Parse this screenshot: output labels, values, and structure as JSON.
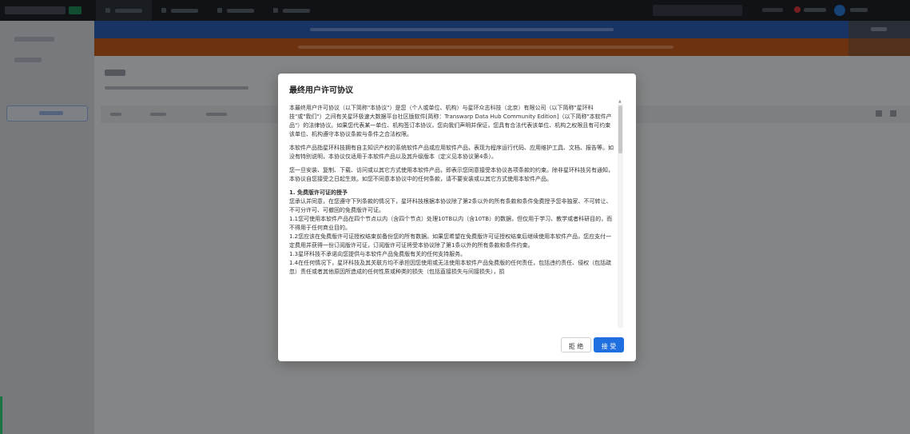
{
  "colors": {
    "accent": "#1f6fe0",
    "top_bar": "#1f2229",
    "banner_blue": "#2d5fb8",
    "banner_orange": "#c75b1d"
  },
  "modal": {
    "title": "最终用户许可协议",
    "paragraphs": [
      "本最终用户许可协议（以下简称\"本协议\"）是您（个人或单位、机构）与星环众志科技（北京）有限公司（以下简称\"星环科技\"或\"我们\"）之间有关星环极速大数据平台社区版软件[简称：Transwarp Data Hub Community Edition]（以下简称\"本软件产品\"）的法律协议。如果您代表某一单位、机构签订本协议，您向我们声明并保证，您具有合法代表该单位、机构之权限且有可约束该单位、机构遵守本协议条款与条件之合法权限。",
      "本软件产品指星环科技拥有自主知识产权的系统软件产品或应用软件产品，表现为程序运行代码、应用维护工具、文档、报告等。如没有特别说明，本协议仅适用于本软件产品以及其升级版本（定义见本协议第4条）。",
      "您一旦安装、复制、下载、访问或以其它方式使用本软件产品，即表示您同意接受本协议各项条款的约束。除非星环科技另有通知，本协议自您接受之日起生效。如您不同意本协议中的任何条款，请不要安装或以其它方式使用本软件产品。"
    ],
    "section_title": "1. 免费版许可证的授予",
    "section_lines": [
      "您承认并同意，在您遵守下列条款的情况下，星环科技根据本协议除了第2条以外的所有条款和条件免费授予您非独家、不可转让、不可分许可、可撤回的免费版许可证。",
      "1.1您可使用本软件产品在四个节点以内（含四个节点）处理10TB以内（含10TB）的数据，但仅用于学习、教学或者科研目的，而不得用于任何商业目的。",
      "1.2您应该在免费版许可证授权结束前备份您的所有数据。如果您希望在免费版许可证授权结束后继续使用本软件产品，您应支付一定费用并获得一份订阅版许可证，订阅版许可证将受本协议除了第1条以外的所有条款和条件约束。",
      "1.3星环科技不承诺向您提供与本软件产品免费版有关的任何支持服务。",
      "1.4在任何情况下，星环科技及其关联方均不承担因您使用或无法使用本软件产品免费版的任何责任，包括违约责任、侵权（包括疏忽）责任或者其他原因所造成的任何性质或种类的损失（包括直接损失与间接损失），损"
    ],
    "reject_label": "拒 绝",
    "accept_label": "接 受"
  }
}
